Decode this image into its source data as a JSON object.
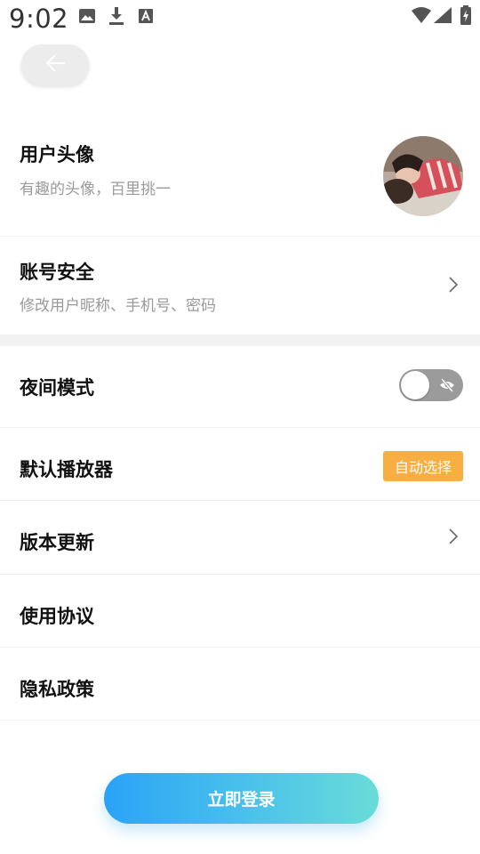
{
  "status_bar": {
    "time": "9:02",
    "icons": [
      "image-icon",
      "download-icon",
      "font-icon",
      "wifi-icon",
      "signal-icon",
      "battery-icon"
    ]
  },
  "header": {
    "back_icon": "arrow-left-icon"
  },
  "profile": {
    "avatar_title": "用户头像",
    "avatar_subtitle": "有趣的头像，百里挑一",
    "security_title": "账号安全",
    "security_subtitle": "修改用户昵称、手机号、密码"
  },
  "settings": {
    "night_mode": {
      "label": "夜间模式",
      "enabled": false
    },
    "default_player": {
      "label": "默认播放器",
      "value": "自动选择"
    },
    "version_update": {
      "label": "版本更新"
    },
    "user_agreement": {
      "label": "使用协议"
    },
    "privacy_policy": {
      "label": "隐私政策"
    }
  },
  "login_button": {
    "label": "立即登录"
  },
  "colors": {
    "accent_orange": "#f7ae42",
    "gradient_start": "#2aa3f7",
    "gradient_end": "#69dcd8",
    "toggle_off": "#9b9b9b"
  }
}
